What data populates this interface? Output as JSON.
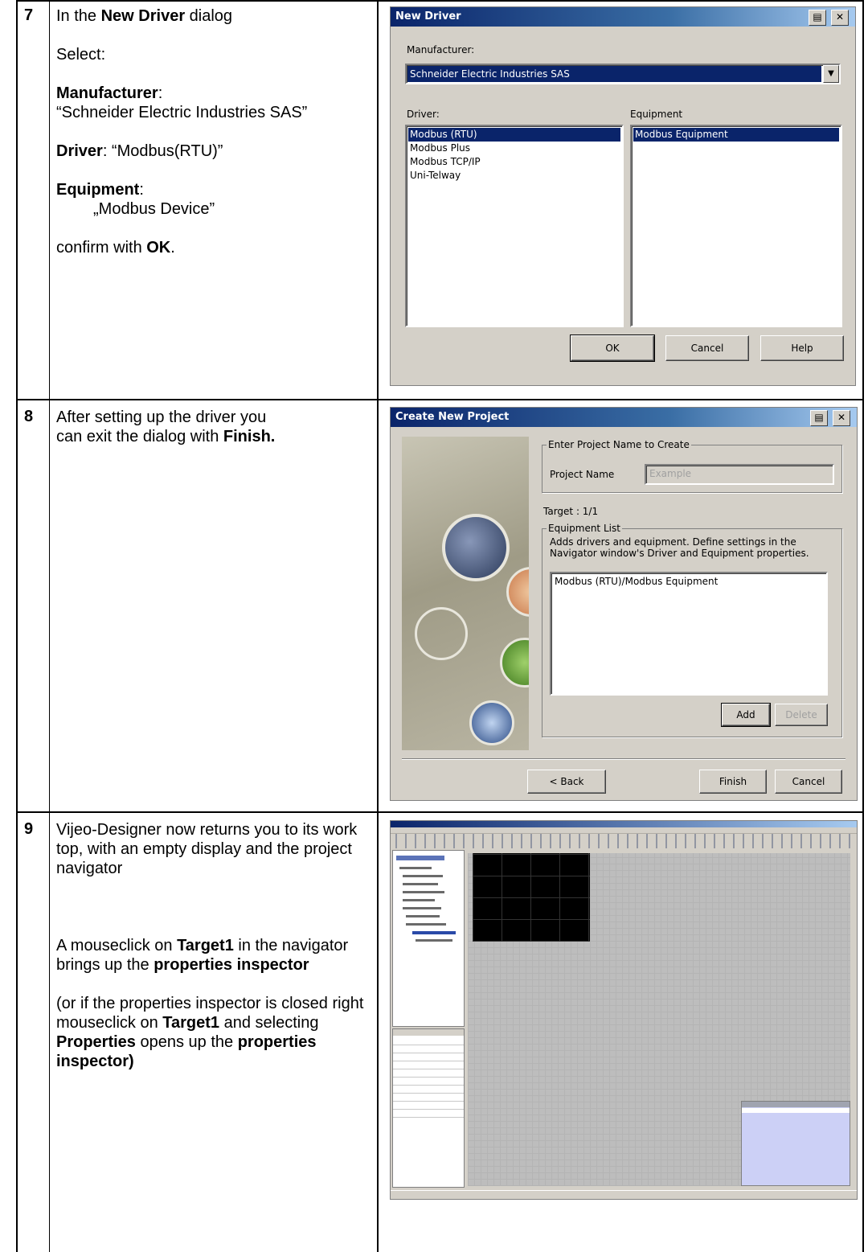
{
  "rows": [
    {
      "number": "7",
      "text": {
        "l1_a": "In the ",
        "l1_b": "New Driver",
        "l1_c": " dialog",
        "l2": "Select:",
        "manufacturer_label": "Manufacturer",
        "colon": ":",
        "manufacturer_value": "“Schneider Electric Industries SAS”",
        "driver_label": "Driver",
        "driver_value": ": “Modbus(RTU)”",
        "equipment_label": "Equipment",
        "equipment_value": "„Modbus Device”",
        "confirm_a": "confirm with ",
        "confirm_b": "OK",
        "confirm_c": "."
      }
    },
    {
      "number": "8",
      "text": {
        "l1": "After setting up the driver you",
        "l2_a": "can exit the dialog with ",
        "l2_b": "Finish."
      }
    },
    {
      "number": "9",
      "text": {
        "p1": "Vijeo-Designer now returns you to its work top, with an empty display and the project navigator",
        "p2_a": "A mouseclick on ",
        "p2_b": "Target1",
        "p2_c": " in the navigator brings up the ",
        "p2_d": "properties inspector",
        "p3_a": "(or if the properties inspector is closed right mouseclick on ",
        "p3_b": "Target1",
        "p3_c": " and selecting ",
        "p3_d": "Properties",
        "p3_e": " opens up the ",
        "p3_f": "properties inspector)"
      }
    }
  ],
  "new_driver": {
    "title": "New Driver",
    "manufacturer_label": "Manufacturer:",
    "manufacturer_value": "Schneider Electric Industries SAS",
    "driver_label": "Driver:",
    "equipment_label": "Equipment",
    "drivers": [
      "Modbus (RTU)",
      "Modbus Plus",
      "Modbus TCP/IP",
      "Uni-Telway"
    ],
    "equipment": [
      "Modbus Equipment"
    ],
    "ok": "OK",
    "cancel": "Cancel",
    "help": "Help"
  },
  "create_project": {
    "title": "Create New Project",
    "group1": "Enter Project Name to Create",
    "project_name_label": "Project Name",
    "project_name_value": "Example",
    "target": "Target : 1/1",
    "group2": "Equipment List",
    "desc": "Adds drivers and equipment. Define settings in the Navigator window's Driver and Equipment properties.",
    "list_item": "Modbus (RTU)/Modbus Equipment",
    "add": "Add",
    "delete": "Delete",
    "back": "< Back",
    "finish": "Finish",
    "cancel": "Cancel"
  }
}
